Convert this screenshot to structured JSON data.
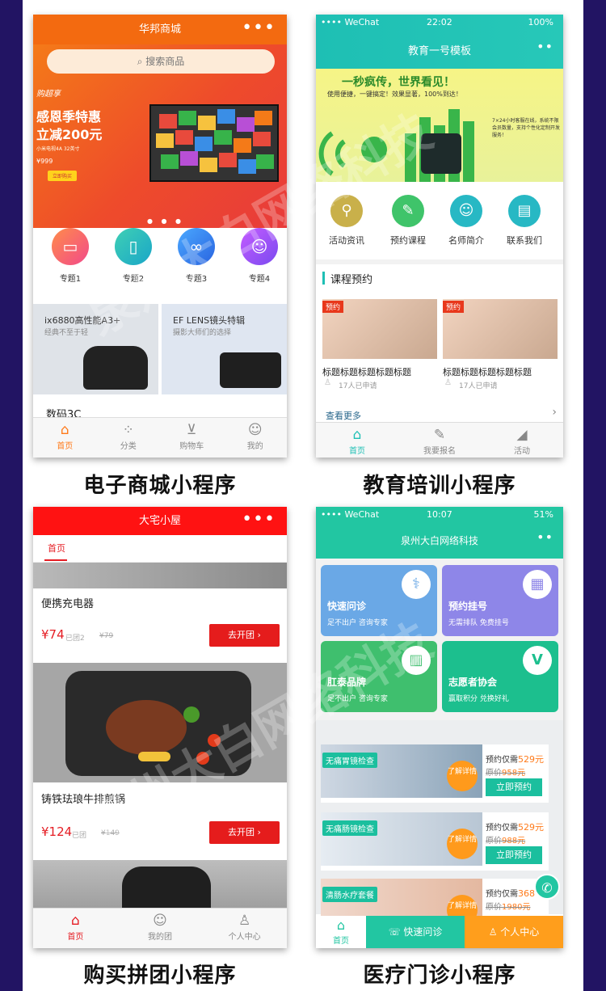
{
  "captions": [
    "电子商城小程序",
    "教育培训小程序",
    "购买拼团小程序",
    "医疗门诊小程序"
  ],
  "watermark": "泉州大白网络科技",
  "p1": {
    "title": "华邦商城",
    "more": "•••",
    "search_placeholder": "搜索商品",
    "banner": {
      "brand": "购超享",
      "headline1": "感恩季特惠",
      "headline2": "立减200元",
      "sub": "小米电视4A 32英寸",
      "price": "¥999",
      "button": "立即购买"
    },
    "categories": [
      "专题1",
      "专题2",
      "专题3",
      "专题4"
    ],
    "promos": [
      {
        "title": "ix6880高性能A3+",
        "sub": "经典不至于轻"
      },
      {
        "title": "EF LENS镜头特辑",
        "sub": "摄影大师们的选择"
      }
    ],
    "section": "数码3C",
    "tabs": [
      "首页",
      "分类",
      "购物车",
      "我的"
    ]
  },
  "p2": {
    "status": {
      "carrier": "•••• WeChat",
      "time": "22:02",
      "battery": "100%"
    },
    "title": "教育一号模板",
    "banner": {
      "headline": "一秒疯传，世界看见！",
      "sub": "使用便捷，一键搞定！效果显著，100%到达！",
      "side": "7×24小时客服在线，系统不限会员数量，支持个性化定制开发服务！"
    },
    "icons": [
      "活动资讯",
      "预约课程",
      "名师简介",
      "联系我们"
    ],
    "section": "课程预约",
    "courses": [
      {
        "badge": "预约",
        "title": "标题标题标题标题标题",
        "count": "17人已申请"
      },
      {
        "badge": "预约",
        "title": "标题标题标题标题标题",
        "count": "17人已申请"
      }
    ],
    "more": "查看更多",
    "tabs": [
      "首页",
      "我要报名",
      "活动"
    ]
  },
  "p3": {
    "title": "大宅小屋",
    "more": "•••",
    "tab": "首页",
    "products": [
      {
        "name": "便携充电器",
        "price": "¥74",
        "grouped": "已团2",
        "orig": "¥79",
        "button": "去开团"
      },
      {
        "name": "铸铁珐琅牛排煎锅",
        "price": "¥124",
        "grouped": "已团",
        "orig": "¥149",
        "button": "去开团"
      }
    ],
    "tabs": [
      "首页",
      "我的团",
      "个人中心"
    ]
  },
  "p4": {
    "status": {
      "carrier": "•••• WeChat",
      "time": "10:07",
      "battery": "51%"
    },
    "title": "泉州大白网络科技",
    "cards": [
      {
        "title": "快速问诊",
        "sub": "足不出户 咨询专家",
        "color": "#6aa8e6"
      },
      {
        "title": "预约挂号",
        "sub": "无需排队 免费挂号",
        "color": "#8e86e8"
      },
      {
        "title": "肛泰品牌",
        "sub": "足不出户 咨询专家",
        "color": "#3fbf6e"
      },
      {
        "title": "志愿者协会",
        "sub": "赢取积分 兑换好礼",
        "color": "#1cbf8e"
      }
    ],
    "promos": [
      {
        "label": "无痛胃镜检查",
        "bubble": "了解详情",
        "price_prefix": "预约仅需",
        "price": "529元",
        "orig_prefix": "原价",
        "orig": "958元",
        "button": "立即预约"
      },
      {
        "label": "无痛肠镜检查",
        "bubble": "了解详情",
        "price_prefix": "预约仅需",
        "price": "529元",
        "orig_prefix": "原价",
        "orig": "988元",
        "button": "立即预约"
      },
      {
        "label": "清肠水疗套餐",
        "bubble": "了解详情",
        "price_prefix": "预约仅需",
        "price": "368",
        "orig_prefix": "原价",
        "orig": "1980元",
        "button": ""
      }
    ],
    "tabs": [
      "首页",
      "快速问诊",
      "个人中心"
    ]
  }
}
